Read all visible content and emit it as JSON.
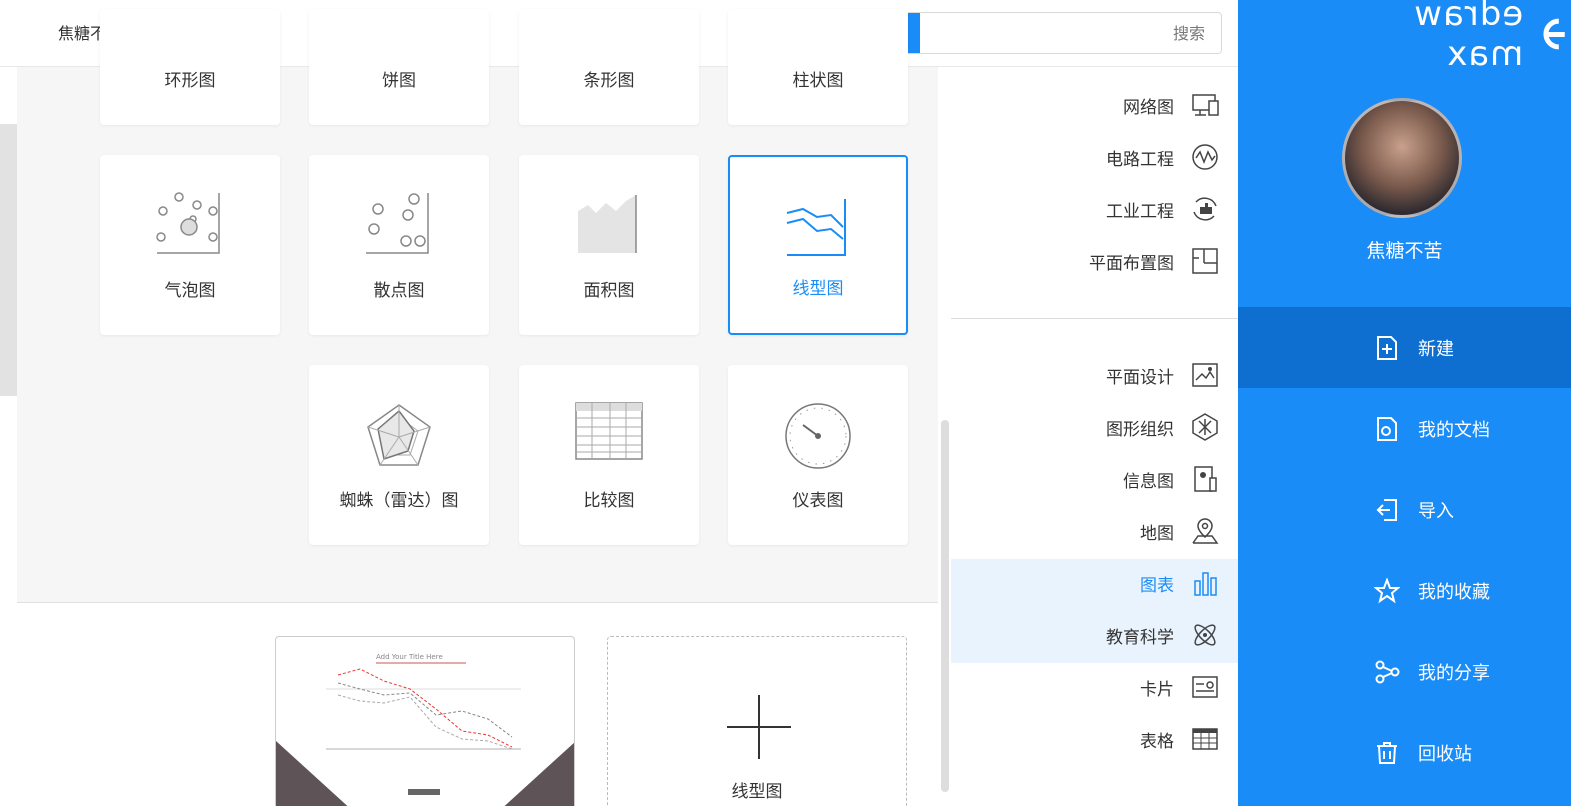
{
  "app": {
    "logo_text": "edraw max"
  },
  "user": {
    "name": "焦糖不苦"
  },
  "search": {
    "button_label": "搜索",
    "placeholder": "搜索"
  },
  "nav": [
    {
      "label": "新建",
      "icon": "new-file-icon",
      "active": true
    },
    {
      "label": "我的文档",
      "icon": "document-icon"
    },
    {
      "label": "导入",
      "icon": "import-icon"
    },
    {
      "label": "我的收藏",
      "icon": "star-icon"
    },
    {
      "label": "我的分享",
      "icon": "share-icon"
    },
    {
      "label": "回收站",
      "icon": "trash-icon"
    }
  ],
  "categories_top": [
    {
      "label": "网络图",
      "icon": "network-icon"
    },
    {
      "label": "电路工程",
      "icon": "circuit-icon"
    },
    {
      "label": "工业工程",
      "icon": "industry-icon"
    },
    {
      "label": "平面布置图",
      "icon": "floorplan-icon"
    }
  ],
  "categories_bottom": [
    {
      "label": "平面设计",
      "icon": "image-icon"
    },
    {
      "label": "图形组织",
      "icon": "graphic-organizer-icon"
    },
    {
      "label": "信息图",
      "icon": "infographic-icon"
    },
    {
      "label": "地图",
      "icon": "map-pin-icon"
    },
    {
      "label": "图表",
      "icon": "bar-chart-icon",
      "active": true
    },
    {
      "label": "教育科学",
      "icon": "atom-icon"
    },
    {
      "label": "卡片",
      "icon": "card-icon"
    },
    {
      "label": "表格",
      "icon": "table-icon"
    }
  ],
  "chart_types": {
    "row0": [
      "柱状图",
      "条形图",
      "饼图",
      "环形图"
    ],
    "row1": [
      "线型图",
      "面积图",
      "散点图",
      "气泡图"
    ],
    "row2": [
      "仪表图",
      "比较图",
      "蜘蛛（雷达）图"
    ],
    "selected": "线型图"
  },
  "templates": {
    "preview_title": "Add Your Title Here",
    "new_label": "线型图"
  },
  "colors": {
    "accent": "#1a8cf7",
    "nav_active": "#0f6fd1",
    "cat_active_bg": "#e9f3fd"
  }
}
